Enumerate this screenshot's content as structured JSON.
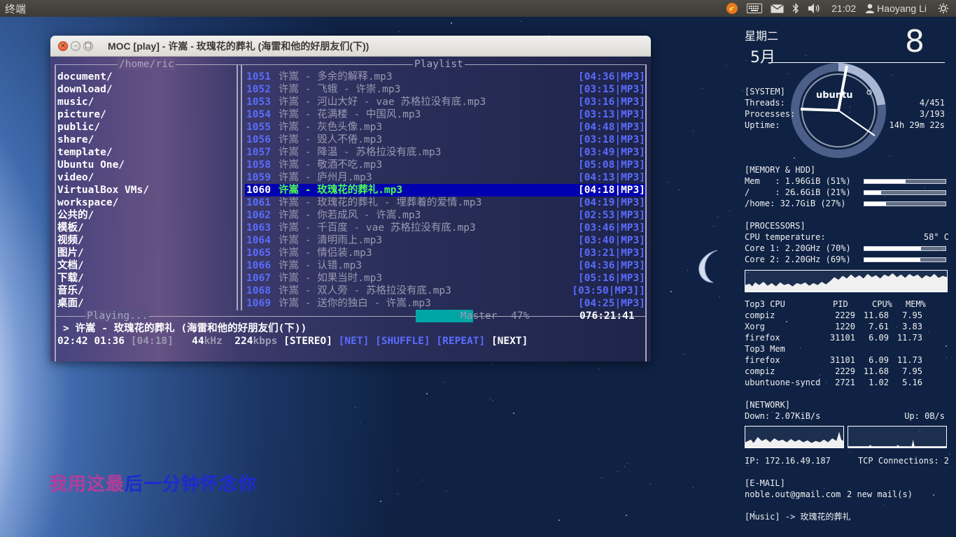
{
  "panel": {
    "app_title": "终端",
    "clock": "21:02",
    "user": "Haoyang Li",
    "indicators": [
      "moc-icon",
      "keyboard-icon",
      "mail-icon",
      "bluetooth-icon",
      "volume-icon"
    ]
  },
  "lyric": {
    "sung": "我用这最",
    "unsung": "后一分钟怀念你"
  },
  "window": {
    "title": "MOC [play] - 许嵩 - 玫瑰花的葬礼 (海雷和他的好朋友们(下))",
    "close": "×",
    "minimize": "–",
    "maximize": "□"
  },
  "moc": {
    "dir_label": "/home/ric",
    "playlist_label": "Playlist",
    "playing_label": "Playing...",
    "directories": [
      "document/",
      "download/",
      "music/",
      "picture/",
      "public/",
      "share/",
      "template/",
      "Ubuntu One/",
      "video/",
      "VirtualBox VMs/",
      "workspace/",
      "公共的/",
      "模板/",
      "视频/",
      "图片/",
      "文档/",
      "下载/",
      "音乐/",
      "桌面/"
    ],
    "playlist": [
      {
        "num": "1051",
        "title": "许嵩 - 多余的解释.mp3",
        "dur": "[04:36|MP3]"
      },
      {
        "num": "1052",
        "title": "许嵩 - 飞蛾 - 许崇.mp3",
        "dur": "[03:15|MP3]"
      },
      {
        "num": "1053",
        "title": "许嵩 - 河山大好 - vae 苏格拉没有底.mp3",
        "dur": "[03:16|MP3]"
      },
      {
        "num": "1054",
        "title": "许嵩 - 花满楼 - 中国风.mp3",
        "dur": "[03:13|MP3]"
      },
      {
        "num": "1055",
        "title": "许嵩 - 灰色头像.mp3",
        "dur": "[04:48|MP3]"
      },
      {
        "num": "1056",
        "title": "许嵩 - 毁人不倦.mp3",
        "dur": "[03:18|MP3]"
      },
      {
        "num": "1057",
        "title": "许嵩 - 降温 - 苏格拉没有底.mp3",
        "dur": "[03:49|MP3]"
      },
      {
        "num": "1058",
        "title": "许嵩 - 敬酒不吃.mp3",
        "dur": "[05:08|MP3]"
      },
      {
        "num": "1059",
        "title": "许嵩 - 庐州月.mp3",
        "dur": "[04:13|MP3]"
      },
      {
        "num": "1060",
        "title": "许嵩 - 玫瑰花的葬礼.mp3",
        "dur": "[04:18|MP3]"
      },
      {
        "num": "1061",
        "title": "许嵩 - 玫瑰花的葬礼 - 埋葬着的爱情.mp3",
        "dur": "[04:19|MP3]"
      },
      {
        "num": "1062",
        "title": "许嵩 - 你若成风 - 许嵩.mp3",
        "dur": "[02:53|MP3]"
      },
      {
        "num": "1063",
        "title": "许嵩 - 千百度 - vae 苏格拉没有底.mp3",
        "dur": "[03:46|MP3]"
      },
      {
        "num": "1064",
        "title": "许嵩 - 清明雨上.mp3",
        "dur": "[03:40|MP3]"
      },
      {
        "num": "1065",
        "title": "许嵩 - 情侣装.mp3",
        "dur": "[03:21|MP3]"
      },
      {
        "num": "1066",
        "title": "许嵩 - 认错.mp3",
        "dur": "[04:36|MP3]"
      },
      {
        "num": "1067",
        "title": "许嵩 - 如果当时.mp3",
        "dur": "[05:16|MP3]"
      },
      {
        "num": "1068",
        "title": "许嵩 - 双人旁 - 苏格拉没有底.mp3",
        "dur": "[03:50|MP3]]"
      },
      {
        "num": "1069",
        "title": "许嵩 - 送你的独白 - 许嵩.mp3",
        "dur": "[04:25|MP3]"
      }
    ],
    "current_index": 9,
    "mixer_label": "Master",
    "volume_percent": "47%",
    "volume_level": 0.47,
    "total_time": "076:21:41",
    "now_playing": "> 许嵩 - 玫瑰花的葬礼 (海雷和他的好朋友们(下))",
    "time_left": "02:42",
    "time_elapsed": "01:36",
    "time_total": "[04:18]",
    "rate": "44",
    "rate_unit": "kHz",
    "bitrate": "224",
    "bitrate_unit": "kbps",
    "flags": {
      "stereo": "[STEREO]",
      "net": "[NET]",
      "shuffle": "[SHUFFLE]",
      "repeat": "[REPEAT]",
      "next": "[NEXT]"
    },
    "progress": 0.37
  },
  "conky": {
    "day_name": "星期二",
    "month": "5月",
    "day": "8",
    "ubuntu_logo": "ubuntu",
    "system": {
      "header": "[SYSTEM]",
      "threads_label": "Threads:",
      "threads": "4/451",
      "processes_label": "Processes:",
      "processes": "3/193",
      "uptime_label": "Uptime:",
      "uptime": "14h 29m 22s"
    },
    "memory": {
      "header": "[MEMORY & HDD]",
      "rows": [
        {
          "label": "Mem   : 1.96GiB (51%)",
          "level": 0.51
        },
        {
          "label": "/     : 26.6GiB (21%)",
          "level": 0.21
        },
        {
          "label": "/home: 32.7GiB (27%)",
          "level": 0.27
        }
      ]
    },
    "processors": {
      "header": "[PROCESSORS]",
      "temp_label": "CPU temperature:",
      "temp": "58° C",
      "cores": [
        {
          "label": "Core 1: 2.20GHz (70%)",
          "level": 0.7
        },
        {
          "label": "Core 2: 2.20GHz (69%)",
          "level": 0.69
        }
      ]
    },
    "top_cpu": {
      "header": "Top3 CPU",
      "col_pid": "PID",
      "col_cpu": "CPU%",
      "col_mem": "MEM%",
      "rows": [
        {
          "name": "compiz",
          "pid": "2229",
          "cpu": "11.68",
          "mem": "7.95"
        },
        {
          "name": "Xorg",
          "pid": "1220",
          "cpu": "7.61",
          "mem": "3.83"
        },
        {
          "name": "firefox",
          "pid": "31101",
          "cpu": "6.09",
          "mem": "11.73"
        }
      ]
    },
    "top_mem": {
      "header": "Top3 Mem",
      "rows": [
        {
          "name": "firefox",
          "pid": "31101",
          "cpu": "6.09",
          "mem": "11.73"
        },
        {
          "name": "compiz",
          "pid": "2229",
          "cpu": "11.68",
          "mem": "7.95"
        },
        {
          "name": "ubuntuone-syncd",
          "pid": "2721",
          "cpu": "1.02",
          "mem": "5.16"
        }
      ]
    },
    "network": {
      "header": "[NETWORK]",
      "down": "Down: 2.07KiB/s",
      "up": "Up: 0B/s",
      "ip": "IP: 172.16.49.187",
      "tcp": "TCP Connections: 2"
    },
    "email": {
      "header": "[E-MAIL]",
      "address": "noble.out@gmail.com",
      "count": "2 new mail(s)"
    },
    "music": "[Music] -> 玫瑰花的葬礼"
  },
  "colors": {
    "panel_bg": "#3c3b37",
    "highlight_row": "#0000b0",
    "current_title": "#4dff4d",
    "number_blue": "#5a6cff",
    "progress": "#00a6a6"
  }
}
